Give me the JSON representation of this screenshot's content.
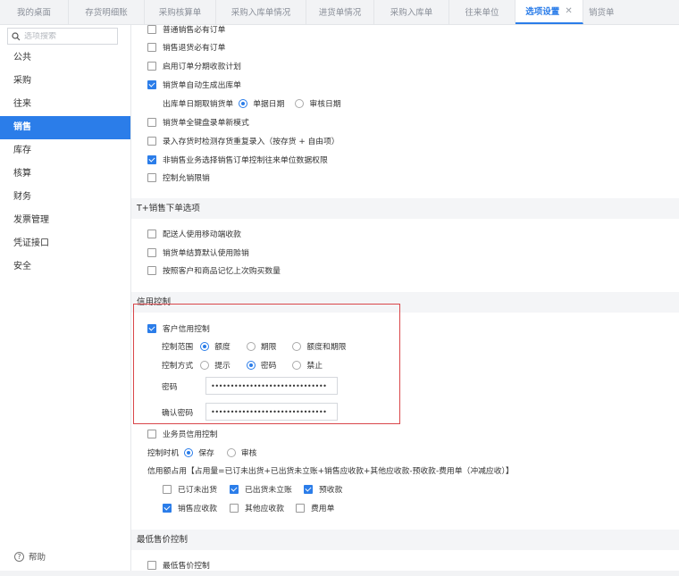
{
  "tabs": [
    {
      "label": "我的桌面"
    },
    {
      "label": "存货明细账"
    },
    {
      "label": "采购核算单"
    },
    {
      "label": "采购入库单情况"
    },
    {
      "label": "进货单情况"
    },
    {
      "label": "采购入库单"
    },
    {
      "label": "往来单位"
    },
    {
      "label": "选项设置",
      "active": true
    },
    {
      "label": "销货单"
    }
  ],
  "tab_close": "✕",
  "sidebar": {
    "search_placeholder": "选项搜索",
    "items": [
      {
        "label": "公共"
      },
      {
        "label": "采购"
      },
      {
        "label": "往来"
      },
      {
        "label": "销售",
        "active": true
      },
      {
        "label": "库存"
      },
      {
        "label": "核算"
      },
      {
        "label": "财务"
      },
      {
        "label": "发票管理"
      },
      {
        "label": "凭证接口"
      },
      {
        "label": "安全"
      }
    ],
    "help_label": "帮助",
    "help_glyph": "?"
  },
  "sales": {
    "opt1": "普通销售必有订单",
    "opt2": "销售退货必有订单",
    "opt3": "启用订单分期收款计划",
    "opt4": "销货单自动生成出库单",
    "outbound_label": "出库单日期取销货单",
    "outbound_opt1": "单据日期",
    "outbound_opt2": "审核日期",
    "opt5": "销货单全键盘录单新模式",
    "opt6": "录入存货时检测存货重复录入（按存货 + 自由项）",
    "opt7": "非销售业务选择销售订单控制往来单位数据权限",
    "opt8": "控制允销限销"
  },
  "tplus": {
    "title": "T+销售下单选项",
    "opt1": "配送人使用移动端收款",
    "opt2": "销货单结算默认使用赊销",
    "opt3": "按照客户和商品记忆上次购买数量"
  },
  "credit": {
    "title": "信用控制",
    "customer": "客户信用控制",
    "range_label": "控制范围",
    "range_opt1": "额度",
    "range_opt2": "期限",
    "range_opt3": "额度和期限",
    "mode_label": "控制方式",
    "mode_opt1": "提示",
    "mode_opt2": "密码",
    "mode_opt3": "禁止",
    "password_label": "密码",
    "password_value": "••••••••••••••••••••••••••••••",
    "confirm_label": "确认密码",
    "confirm_value": "••••••••••••••••••••••••••••••",
    "salesperson": "业务员信用控制",
    "timing_label": "控制时机",
    "timing_opt1": "保存",
    "timing_opt2": "审核",
    "formula": "信用额占用【占用量=已订未出货+已出货未立账+销售应收款+其他应收款-预收款-费用单（冲减应收）】",
    "f1": "已订未出货",
    "f2": "已出货未立账",
    "f3": "预收款",
    "f4": "销售应收款",
    "f5": "其他应收款",
    "f6": "费用单"
  },
  "minprice": {
    "title": "最低售价控制",
    "opt1": "最低售价控制"
  },
  "colors": {
    "accent": "#2b7de9",
    "highlight_border": "#d9464a"
  }
}
